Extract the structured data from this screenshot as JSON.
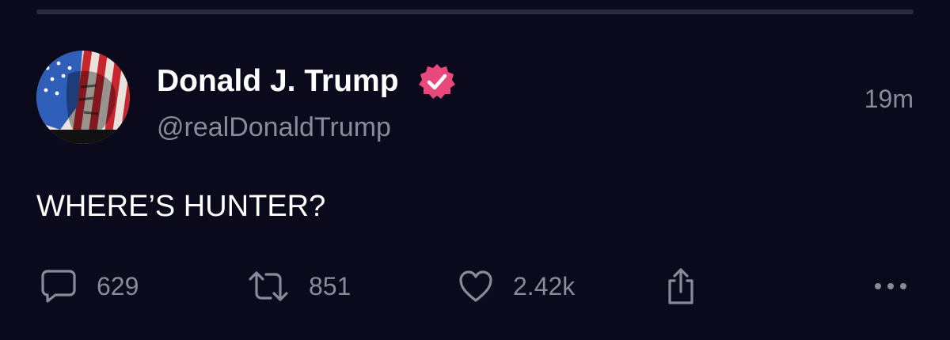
{
  "post": {
    "author": {
      "display_name": "Donald J. Trump",
      "handle": "@realDonaldTrump",
      "verified": true,
      "badge_color": "#e8497a"
    },
    "timestamp": "19m",
    "text": "WHERE’S HUNTER?",
    "actions": {
      "replies": "629",
      "reposts": "851",
      "likes": "2.42k"
    }
  },
  "icons": [
    "reply-icon",
    "repost-icon",
    "like-icon",
    "share-icon",
    "more-icon"
  ],
  "colors": {
    "background": "#0b0a1c",
    "text_primary": "#ffffff",
    "text_secondary": "#8a8a9c",
    "divider": "#2a2940"
  }
}
